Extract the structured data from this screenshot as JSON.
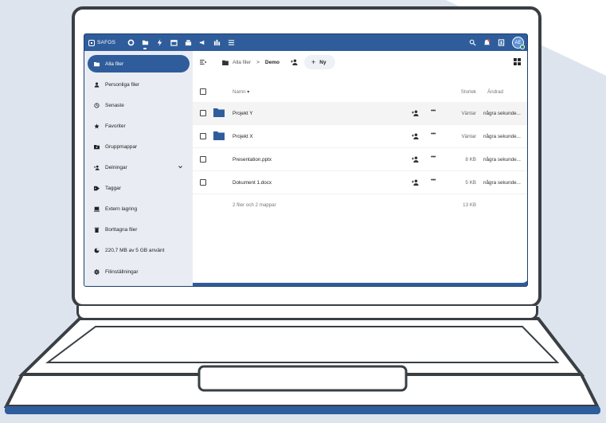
{
  "colors": {
    "accent": "#2f5d9b",
    "sidebar_bg": "#e9edf3",
    "page_bg_shape": "#dde4ee",
    "frame": "#3a3f44"
  },
  "brand": {
    "name": "SAFOS"
  },
  "topbar": {
    "apps": [
      {
        "icon": "circle-icon"
      },
      {
        "icon": "folder-icon",
        "active": true
      },
      {
        "icon": "activity-icon"
      },
      {
        "icon": "calendar-icon"
      },
      {
        "icon": "deck-icon"
      },
      {
        "icon": "announcement-icon"
      },
      {
        "icon": "stats-icon"
      },
      {
        "icon": "tasks-icon"
      }
    ],
    "right": [
      "search-icon",
      "notifications-icon",
      "contacts-icon"
    ],
    "avatar": "AE"
  },
  "sidebar": {
    "items": [
      {
        "label": "Alla filer",
        "icon": "folder-icon",
        "active": true
      },
      {
        "label": "Personliga filer",
        "icon": "person-icon"
      },
      {
        "label": "Senaste",
        "icon": "history-icon"
      },
      {
        "label": "Favoriter",
        "icon": "star-icon"
      },
      {
        "label": "Gruppmappar",
        "icon": "group-folder-icon"
      },
      {
        "label": "Delningar",
        "icon": "share-icon",
        "expandable": true
      },
      {
        "label": "Taggar",
        "icon": "tag-icon"
      },
      {
        "label": "Extern lagring",
        "icon": "external-storage-icon"
      },
      {
        "label": "Borttagna filer",
        "icon": "trash-icon"
      },
      {
        "label": "220,7 MB av 5 GB använt",
        "icon": "pie-chart-icon"
      },
      {
        "label": "Filinställningar",
        "icon": "settings-icon"
      }
    ],
    "quota_used_fraction": 0.04
  },
  "breadcrumb": {
    "root": "Alla filer",
    "separator": ">",
    "current": "Demo",
    "new_button": "Ny",
    "new_plus": "+"
  },
  "table": {
    "headers": {
      "name": "Namn",
      "sort_arrow": "▾",
      "size": "Storlek",
      "modified": "Ändrad"
    },
    "rows": [
      {
        "name": "Projekt Y",
        "type": "folder",
        "size": "Väntar",
        "modified": "några sekunde..."
      },
      {
        "name": "Projekt X",
        "type": "folder",
        "size": "Väntar",
        "modified": "några sekunde..."
      },
      {
        "name": "Presentation.pptx",
        "type": "file",
        "size": "8 KB",
        "modified": "några sekunde..."
      },
      {
        "name": "Dokument 1.docx",
        "type": "file",
        "size": "5 KB",
        "modified": "några sekunde..."
      }
    ],
    "summary": {
      "text": "2 filer och 2 mappar",
      "size": "13 KB"
    }
  }
}
